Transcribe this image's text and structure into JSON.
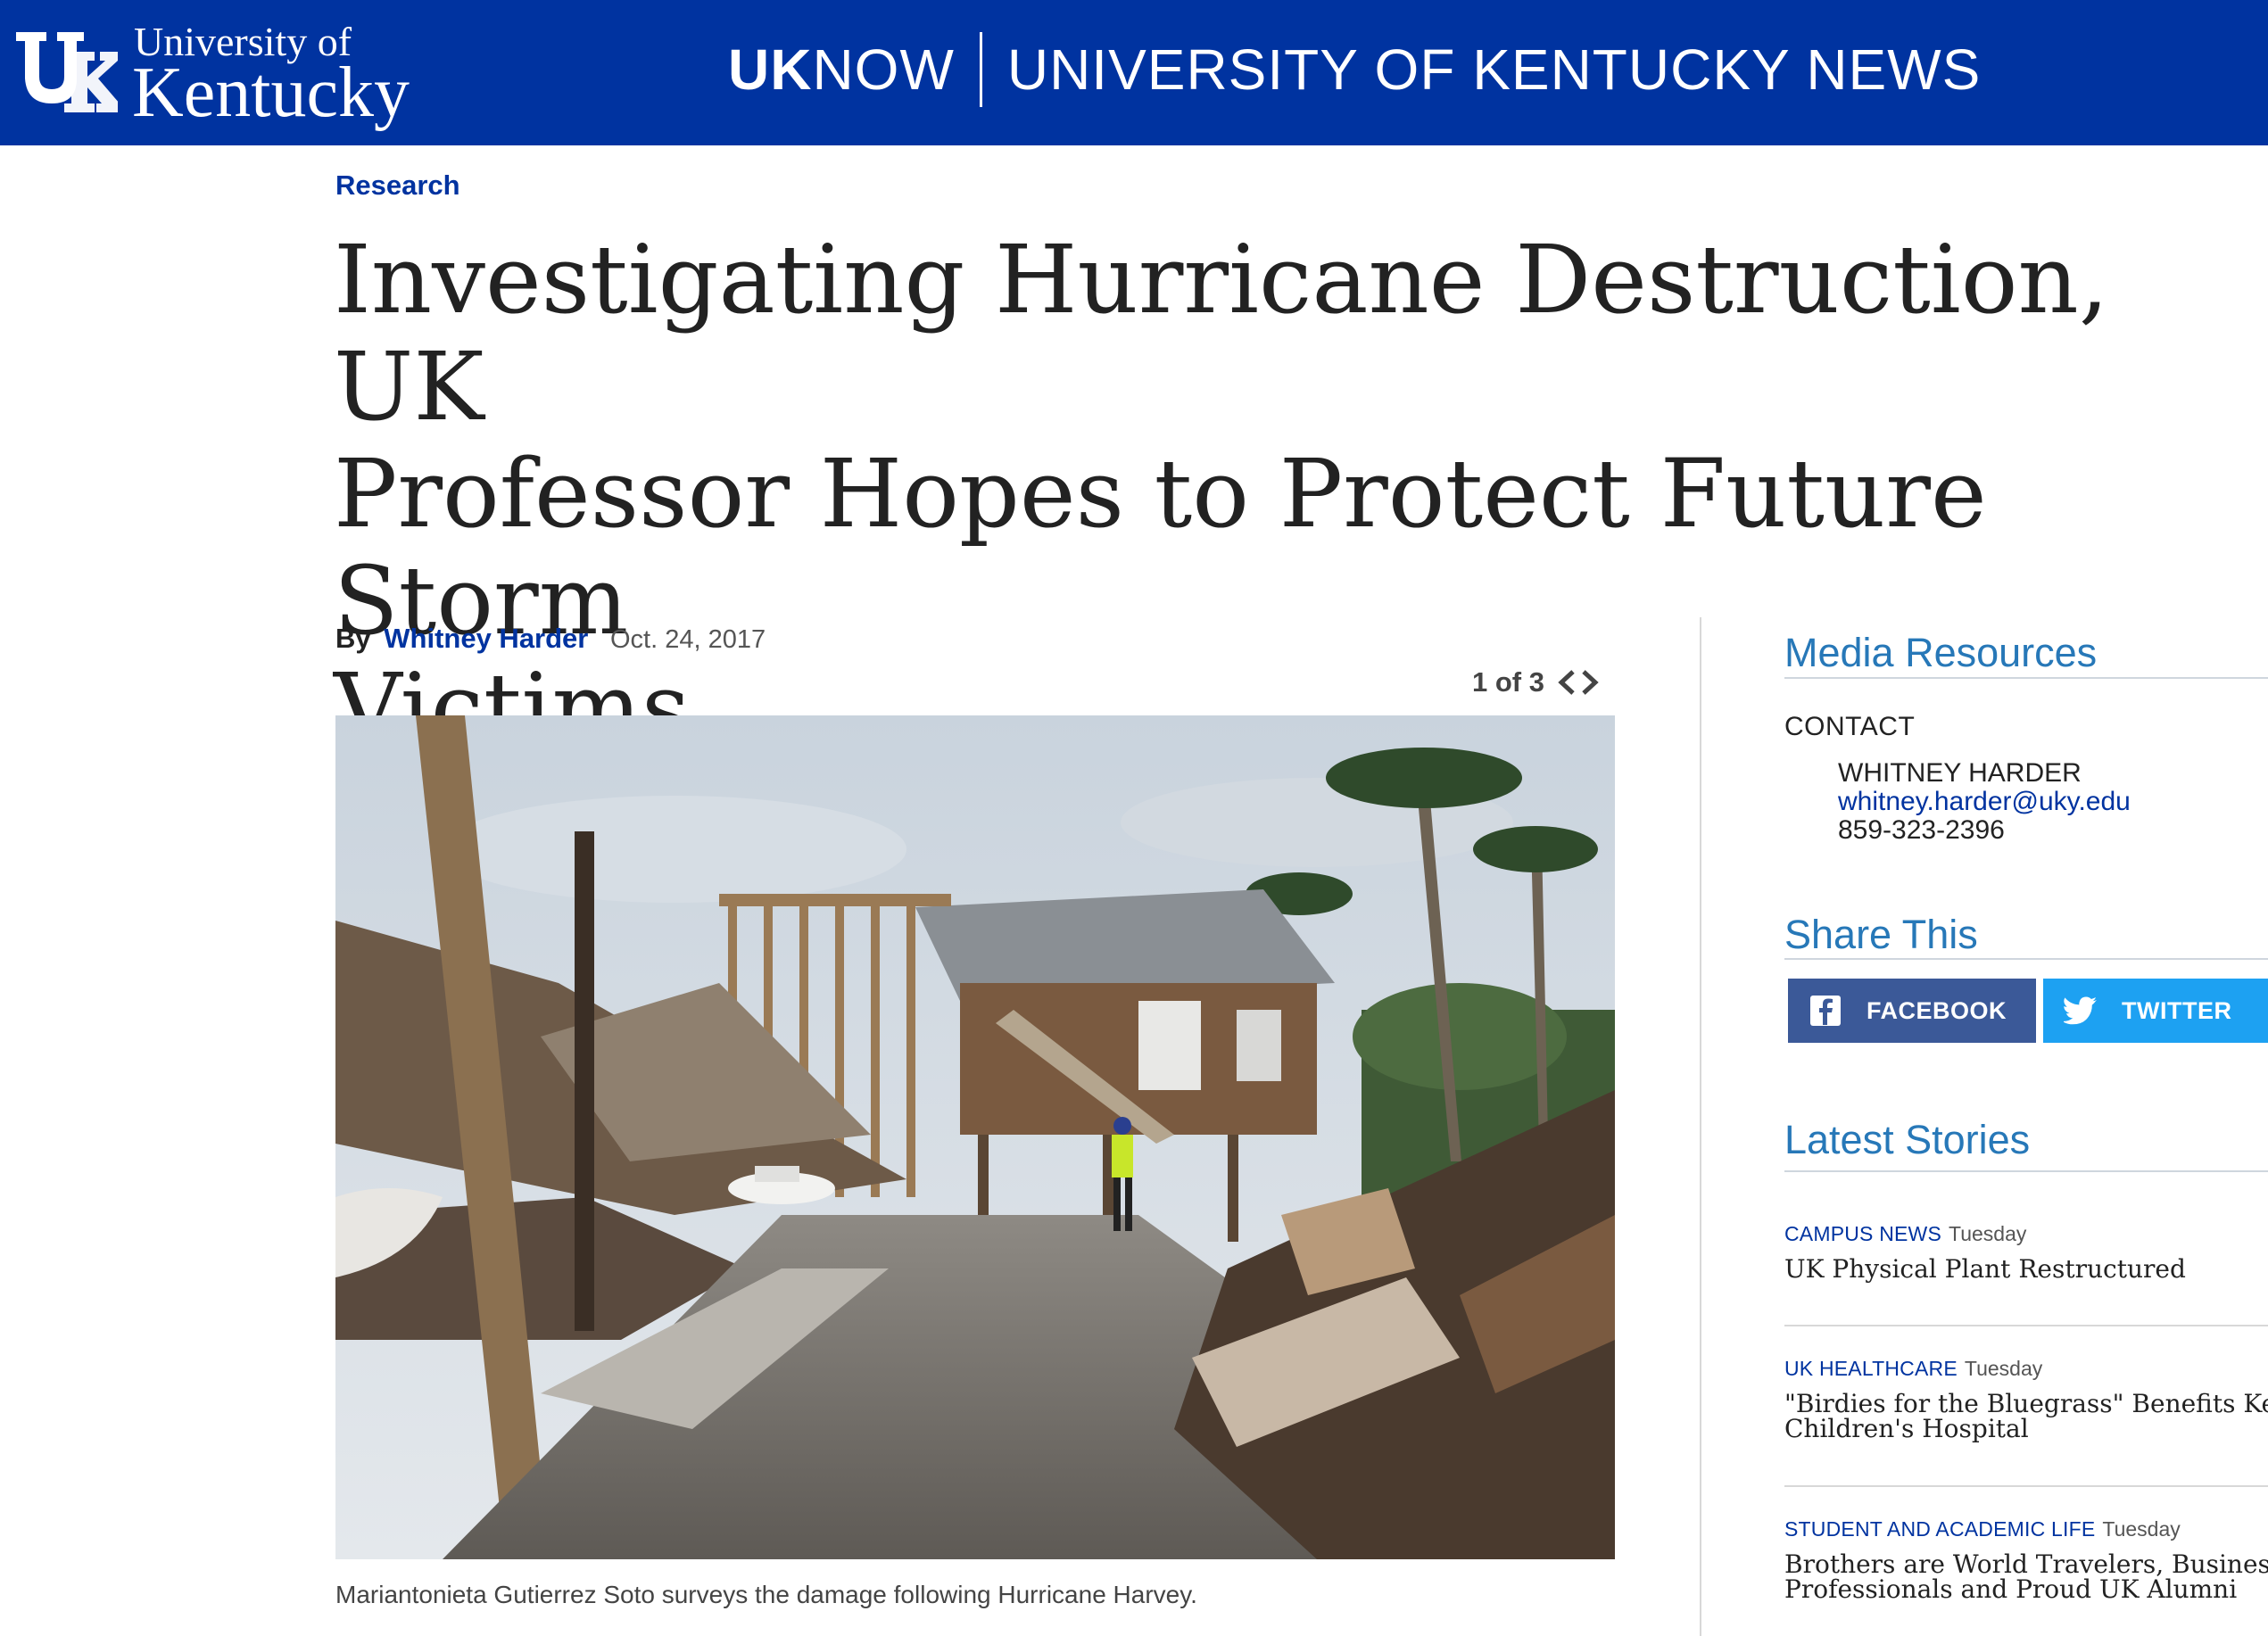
{
  "header": {
    "logo_line1": "University of",
    "logo_line2": "Kentucky",
    "site_uk": "UK",
    "site_now": "NOW",
    "site_full": "UNIVERSITY OF KENTUCKY NEWS",
    "bg_color": "#0033a0"
  },
  "article": {
    "category": "Research",
    "headline_line1": "Investigating Hurricane Destruction, UK",
    "headline_line2": "Professor Hopes to Protect Future Storm",
    "headline_line3": "Victims",
    "by_label": "By",
    "author": "Whitney Harder",
    "date": "Oct. 24, 2017",
    "gallery_counter": "1 of 3",
    "caption": "Mariantonieta Gutierrez Soto surveys the damage following Hurricane Harvey."
  },
  "sidebar": {
    "media_heading": "Media Resources",
    "contact_label": "CONTACT",
    "contact_name": "WHITNEY HARDER",
    "contact_email": "whitney.harder@uky.edu",
    "contact_phone": "859-323-2396",
    "share_heading": "Share This",
    "facebook_label": "FACEBOOK",
    "twitter_label": "TWITTER",
    "latest_heading": "Latest Stories",
    "stories": [
      {
        "category": "CAMPUS NEWS",
        "day": "Tuesday",
        "title_line1": "UK Physical Plant Restructured",
        "title_line2": ""
      },
      {
        "category": "UK HEALTHCARE",
        "day": "Tuesday",
        "title_line1": "\"Birdies for the Bluegrass\" Benefits Kentuc",
        "title_line2": "Children's Hospital"
      },
      {
        "category": "STUDENT AND ACADEMIC LIFE",
        "day": "Tuesday",
        "title_line1": "Brothers are World Travelers, Business",
        "title_line2": "Professionals and Proud UK Alumni"
      }
    ],
    "accent_color": "#2778b8",
    "facebook_color": "#3b5998",
    "twitter_color": "#1da1f2"
  }
}
